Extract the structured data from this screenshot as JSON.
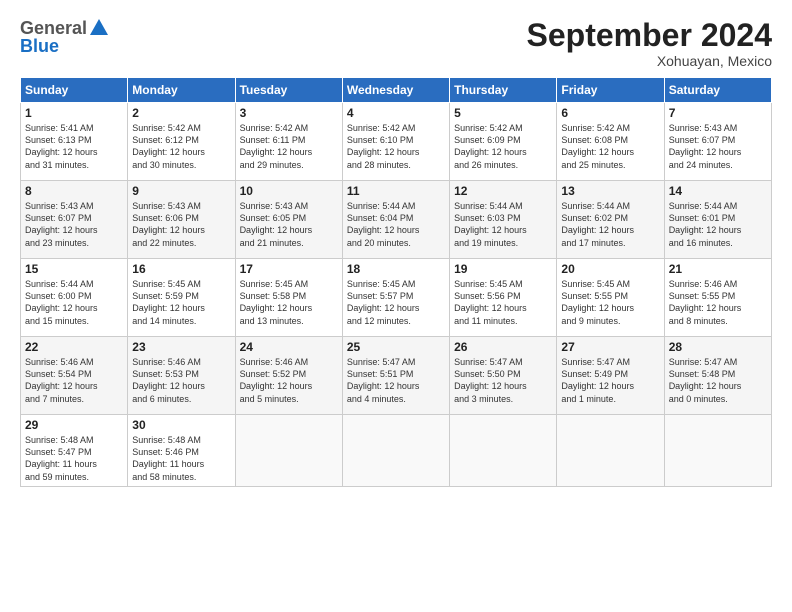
{
  "header": {
    "logo_line1": "General",
    "logo_line2": "Blue",
    "month_title": "September 2024",
    "location": "Xohuayan, Mexico"
  },
  "weekdays": [
    "Sunday",
    "Monday",
    "Tuesday",
    "Wednesday",
    "Thursday",
    "Friday",
    "Saturday"
  ],
  "weeks": [
    [
      {
        "day": "1",
        "info": "Sunrise: 5:41 AM\nSunset: 6:13 PM\nDaylight: 12 hours\nand 31 minutes."
      },
      {
        "day": "2",
        "info": "Sunrise: 5:42 AM\nSunset: 6:12 PM\nDaylight: 12 hours\nand 30 minutes."
      },
      {
        "day": "3",
        "info": "Sunrise: 5:42 AM\nSunset: 6:11 PM\nDaylight: 12 hours\nand 29 minutes."
      },
      {
        "day": "4",
        "info": "Sunrise: 5:42 AM\nSunset: 6:10 PM\nDaylight: 12 hours\nand 28 minutes."
      },
      {
        "day": "5",
        "info": "Sunrise: 5:42 AM\nSunset: 6:09 PM\nDaylight: 12 hours\nand 26 minutes."
      },
      {
        "day": "6",
        "info": "Sunrise: 5:42 AM\nSunset: 6:08 PM\nDaylight: 12 hours\nand 25 minutes."
      },
      {
        "day": "7",
        "info": "Sunrise: 5:43 AM\nSunset: 6:07 PM\nDaylight: 12 hours\nand 24 minutes."
      }
    ],
    [
      {
        "day": "8",
        "info": "Sunrise: 5:43 AM\nSunset: 6:07 PM\nDaylight: 12 hours\nand 23 minutes."
      },
      {
        "day": "9",
        "info": "Sunrise: 5:43 AM\nSunset: 6:06 PM\nDaylight: 12 hours\nand 22 minutes."
      },
      {
        "day": "10",
        "info": "Sunrise: 5:43 AM\nSunset: 6:05 PM\nDaylight: 12 hours\nand 21 minutes."
      },
      {
        "day": "11",
        "info": "Sunrise: 5:44 AM\nSunset: 6:04 PM\nDaylight: 12 hours\nand 20 minutes."
      },
      {
        "day": "12",
        "info": "Sunrise: 5:44 AM\nSunset: 6:03 PM\nDaylight: 12 hours\nand 19 minutes."
      },
      {
        "day": "13",
        "info": "Sunrise: 5:44 AM\nSunset: 6:02 PM\nDaylight: 12 hours\nand 17 minutes."
      },
      {
        "day": "14",
        "info": "Sunrise: 5:44 AM\nSunset: 6:01 PM\nDaylight: 12 hours\nand 16 minutes."
      }
    ],
    [
      {
        "day": "15",
        "info": "Sunrise: 5:44 AM\nSunset: 6:00 PM\nDaylight: 12 hours\nand 15 minutes."
      },
      {
        "day": "16",
        "info": "Sunrise: 5:45 AM\nSunset: 5:59 PM\nDaylight: 12 hours\nand 14 minutes."
      },
      {
        "day": "17",
        "info": "Sunrise: 5:45 AM\nSunset: 5:58 PM\nDaylight: 12 hours\nand 13 minutes."
      },
      {
        "day": "18",
        "info": "Sunrise: 5:45 AM\nSunset: 5:57 PM\nDaylight: 12 hours\nand 12 minutes."
      },
      {
        "day": "19",
        "info": "Sunrise: 5:45 AM\nSunset: 5:56 PM\nDaylight: 12 hours\nand 11 minutes."
      },
      {
        "day": "20",
        "info": "Sunrise: 5:45 AM\nSunset: 5:55 PM\nDaylight: 12 hours\nand 9 minutes."
      },
      {
        "day": "21",
        "info": "Sunrise: 5:46 AM\nSunset: 5:55 PM\nDaylight: 12 hours\nand 8 minutes."
      }
    ],
    [
      {
        "day": "22",
        "info": "Sunrise: 5:46 AM\nSunset: 5:54 PM\nDaylight: 12 hours\nand 7 minutes."
      },
      {
        "day": "23",
        "info": "Sunrise: 5:46 AM\nSunset: 5:53 PM\nDaylight: 12 hours\nand 6 minutes."
      },
      {
        "day": "24",
        "info": "Sunrise: 5:46 AM\nSunset: 5:52 PM\nDaylight: 12 hours\nand 5 minutes."
      },
      {
        "day": "25",
        "info": "Sunrise: 5:47 AM\nSunset: 5:51 PM\nDaylight: 12 hours\nand 4 minutes."
      },
      {
        "day": "26",
        "info": "Sunrise: 5:47 AM\nSunset: 5:50 PM\nDaylight: 12 hours\nand 3 minutes."
      },
      {
        "day": "27",
        "info": "Sunrise: 5:47 AM\nSunset: 5:49 PM\nDaylight: 12 hours\nand 1 minute."
      },
      {
        "day": "28",
        "info": "Sunrise: 5:47 AM\nSunset: 5:48 PM\nDaylight: 12 hours\nand 0 minutes."
      }
    ],
    [
      {
        "day": "29",
        "info": "Sunrise: 5:48 AM\nSunset: 5:47 PM\nDaylight: 11 hours\nand 59 minutes."
      },
      {
        "day": "30",
        "info": "Sunrise: 5:48 AM\nSunset: 5:46 PM\nDaylight: 11 hours\nand 58 minutes."
      },
      {
        "day": "",
        "info": ""
      },
      {
        "day": "",
        "info": ""
      },
      {
        "day": "",
        "info": ""
      },
      {
        "day": "",
        "info": ""
      },
      {
        "day": "",
        "info": ""
      }
    ]
  ]
}
